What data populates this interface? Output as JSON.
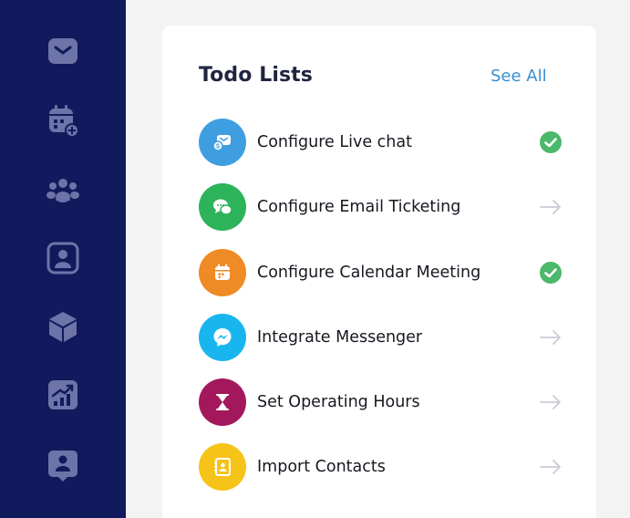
{
  "colors": {
    "sidebar_bg": "#111a5c",
    "sidebar_icon": "#6c74a8",
    "accent_link": "#3a8fd0",
    "check_green": "#4cb86b",
    "arrow_grey": "#c9cbd6"
  },
  "sidebar": {
    "items": [
      {
        "icon": "mail-icon"
      },
      {
        "icon": "calendar-add-icon"
      },
      {
        "icon": "team-icon"
      },
      {
        "icon": "contact-card-icon"
      },
      {
        "icon": "box-icon"
      },
      {
        "icon": "chart-icon"
      },
      {
        "icon": "user-badge-icon"
      }
    ]
  },
  "card": {
    "title": "Todo Lists",
    "see_all": "See All",
    "items": [
      {
        "label": "Configure Live chat",
        "icon": "live-chat-icon",
        "icon_color": "#3f9ee0",
        "status": "completed"
      },
      {
        "label": "Configure Email Ticketing",
        "icon": "email-ticket-icon",
        "icon_color": "#2db35a",
        "status": "pending"
      },
      {
        "label": "Configure Calendar Meeting",
        "icon": "calendar-icon",
        "icon_color": "#f08a24",
        "status": "completed"
      },
      {
        "label": "Integrate Messenger",
        "icon": "messenger-icon",
        "icon_color": "#19b5ef",
        "status": "pending"
      },
      {
        "label": "Set Operating Hours",
        "icon": "hourglass-icon",
        "icon_color": "#a3185c",
        "status": "pending"
      },
      {
        "label": "Import Contacts",
        "icon": "contacts-book-icon",
        "icon_color": "#f6c319",
        "status": "pending"
      }
    ]
  }
}
